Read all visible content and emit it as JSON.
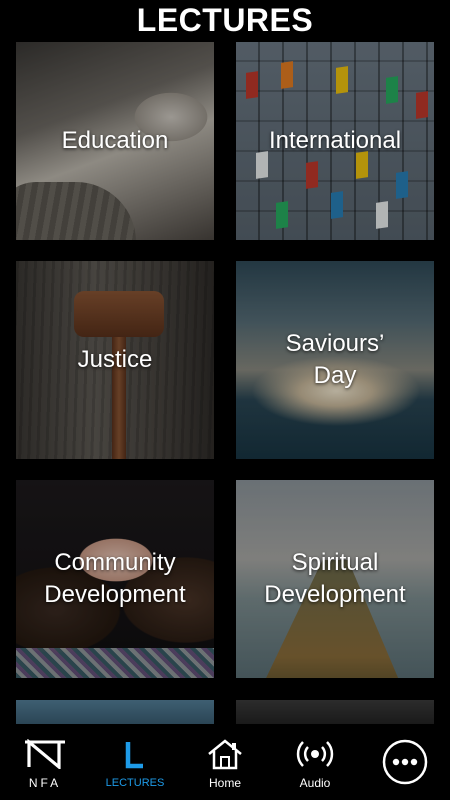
{
  "header": {
    "title": "LECTURES"
  },
  "tiles": [
    {
      "id": "education",
      "label": "Education"
    },
    {
      "id": "international",
      "label": "International"
    },
    {
      "id": "justice",
      "label": "Justice"
    },
    {
      "id": "saviours",
      "label": "Saviours’\nDay"
    },
    {
      "id": "community",
      "label": "Community\nDevelopment"
    },
    {
      "id": "spiritual",
      "label": "Spiritual\nDevelopment"
    }
  ],
  "nav": {
    "items": [
      {
        "id": "nfa",
        "label": "NFA",
        "icon": "nfa-logo-icon"
      },
      {
        "id": "lectures",
        "label": "LECTURES",
        "icon": "lectures-l-icon",
        "active": true
      },
      {
        "id": "home",
        "label": "Home",
        "icon": "home-icon"
      },
      {
        "id": "audio",
        "label": "Audio",
        "icon": "broadcast-icon"
      },
      {
        "id": "more",
        "label": "",
        "icon": "more-icon"
      }
    ]
  },
  "colors": {
    "accent": "#1e9be8",
    "background": "#000000"
  }
}
